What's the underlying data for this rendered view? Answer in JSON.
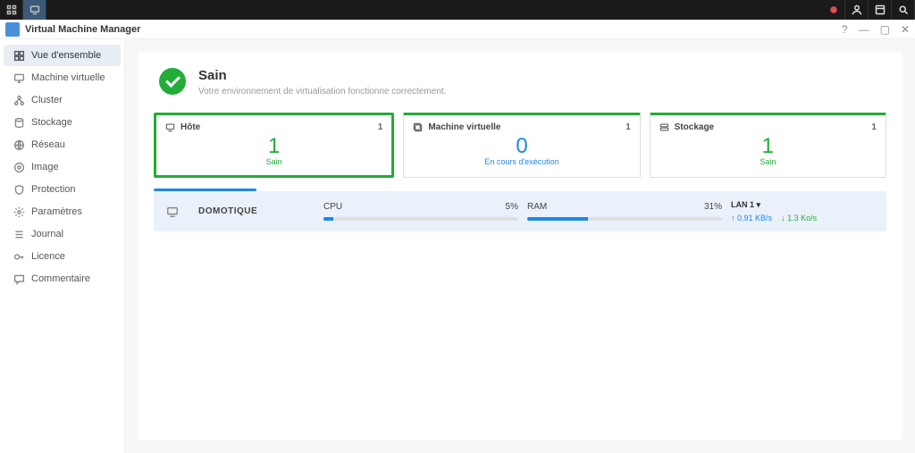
{
  "taskbar": {
    "left": [
      "grid-icon",
      "app-icon"
    ]
  },
  "window": {
    "title": "Virtual Machine Manager",
    "help": "?",
    "minimize": "—",
    "maximize": "▢",
    "close": "✕"
  },
  "sidebar": {
    "items": [
      {
        "label": "Vue d'ensemble",
        "icon": "overview",
        "active": true
      },
      {
        "label": "Machine virtuelle",
        "icon": "vm",
        "active": false
      },
      {
        "label": "Cluster",
        "icon": "cluster",
        "active": false
      },
      {
        "label": "Stockage",
        "icon": "storage",
        "active": false
      },
      {
        "label": "Réseau",
        "icon": "network",
        "active": false
      },
      {
        "label": "Image",
        "icon": "image",
        "active": false
      },
      {
        "label": "Protection",
        "icon": "protection",
        "active": false
      },
      {
        "label": "Paramètres",
        "icon": "settings",
        "active": false
      },
      {
        "label": "Journal",
        "icon": "journal",
        "active": false
      },
      {
        "label": "Licence",
        "icon": "license",
        "active": false
      },
      {
        "label": "Commentaire",
        "icon": "comment",
        "active": false
      }
    ]
  },
  "health": {
    "title": "Sain",
    "description": "Votre environnement de virtualisation fonctionne correctement."
  },
  "cards": [
    {
      "title": "Hôte",
      "count": "1",
      "value": "1",
      "status": "Sain",
      "color": "green",
      "selected": true
    },
    {
      "title": "Machine virtuelle",
      "count": "1",
      "value": "0",
      "status": "En cours d'exécution",
      "color": "blue",
      "selected": false
    },
    {
      "title": "Stockage",
      "count": "1",
      "value": "1",
      "status": "Sain",
      "color": "green",
      "selected": false
    }
  ],
  "host": {
    "name": "DOMOTIQUE",
    "cpu": {
      "label": "CPU",
      "percent": "5%",
      "bar": 5
    },
    "ram": {
      "label": "RAM",
      "percent": "31%",
      "bar": 31
    },
    "lan": {
      "label": "LAN 1 ",
      "up": "0.91 KB/s",
      "down": "1.3 Ko/s"
    }
  }
}
